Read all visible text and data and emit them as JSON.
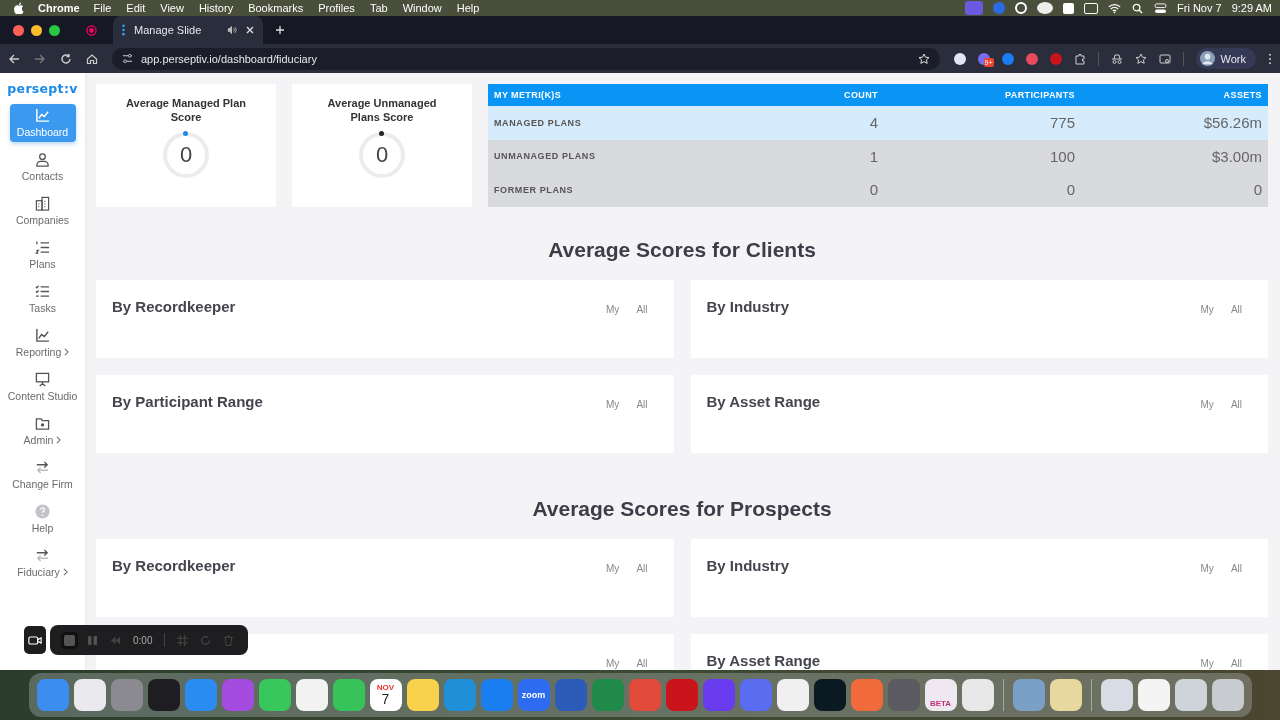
{
  "menu_bar": {
    "app": "Chrome",
    "menus": [
      "File",
      "Edit",
      "View",
      "History",
      "Bookmarks",
      "Profiles",
      "Tab",
      "Window",
      "Help"
    ],
    "date": "Fri Nov 7",
    "time": "9:29 AM"
  },
  "browser": {
    "tab": {
      "title": "Manage Slide"
    },
    "url": "app.perseptiv.io/dashboard/fiduciary",
    "extension_badge": "9+",
    "profile": "Work"
  },
  "sidebar": {
    "logo": "persept:v",
    "items": [
      {
        "label": "Dashboard",
        "kind": "chart",
        "selected": true,
        "has_submenu": false
      },
      {
        "label": "Contacts",
        "kind": "person",
        "selected": false,
        "has_submenu": false
      },
      {
        "label": "Companies",
        "kind": "building",
        "selected": false,
        "has_submenu": false
      },
      {
        "label": "Plans",
        "kind": "numbered",
        "selected": false,
        "has_submenu": false
      },
      {
        "label": "Tasks",
        "kind": "checklist",
        "selected": false,
        "has_submenu": false
      },
      {
        "label": "Reporting",
        "kind": "chart",
        "selected": false,
        "has_submenu": true
      },
      {
        "label": "Content Studio",
        "kind": "easel",
        "selected": false,
        "has_submenu": false
      },
      {
        "label": "Admin",
        "kind": "folder",
        "selected": false,
        "has_submenu": true
      },
      {
        "label": "Change Firm",
        "kind": "swap",
        "selected": false,
        "has_submenu": false
      },
      {
        "label": "Help",
        "kind": "help",
        "selected": false,
        "has_submenu": false
      },
      {
        "label": "Fiduciary",
        "kind": "swap",
        "selected": false,
        "has_submenu": true
      }
    ]
  },
  "score_cards": [
    {
      "title": "Average Managed Plan Score",
      "value": "0",
      "color": "#1e88e5"
    },
    {
      "title": "Average Unmanaged Plans Score",
      "value": "0",
      "color": "#222222"
    }
  ],
  "metrics_table": {
    "columns": [
      "MY METRI(K)S",
      "COUNT",
      "PARTICIPANTS",
      "ASSETS"
    ],
    "rows": [
      {
        "cells": [
          "MANAGED PLANS",
          "4",
          "775",
          "$56.26m"
        ],
        "selected": true
      },
      {
        "cells": [
          "UNMANAGED PLANS",
          "1",
          "100",
          "$3.00m"
        ],
        "selected": false
      },
      {
        "cells": [
          "FORMER PLANS",
          "0",
          "0",
          "0"
        ],
        "selected": false
      }
    ]
  },
  "sections": [
    {
      "heading": "Average Scores for Clients",
      "cards": [
        {
          "title": "By Recordkeeper",
          "filters": [
            "My",
            "All"
          ]
        },
        {
          "title": "By Industry",
          "filters": [
            "My",
            "All"
          ]
        },
        {
          "title": "By Participant Range",
          "filters": [
            "My",
            "All"
          ]
        },
        {
          "title": "By Asset Range",
          "filters": [
            "My",
            "All"
          ]
        }
      ]
    },
    {
      "heading": "Average Scores for Prospects",
      "cards": [
        {
          "title": "By Recordkeeper",
          "filters": [
            "My",
            "All"
          ]
        },
        {
          "title": "By Industry",
          "filters": [
            "My",
            "All"
          ]
        },
        {
          "filters": [
            "My",
            "All"
          ]
        },
        {
          "title": "By Asset Range",
          "filters": [
            "My",
            "All"
          ]
        }
      ]
    }
  ],
  "recorder": {
    "elapsed": "0:00"
  },
  "dock": [
    {
      "kind": "app",
      "color": "#3b8ef0"
    },
    {
      "kind": "app",
      "color": "#e9e9ee"
    },
    {
      "kind": "app",
      "color": "#8a8a90"
    },
    {
      "kind": "app",
      "color": "#1d1d22"
    },
    {
      "kind": "app",
      "color": "#2a8cf0"
    },
    {
      "kind": "app",
      "color": "#a44be0"
    },
    {
      "kind": "app",
      "color": "#37c75a"
    },
    {
      "kind": "app",
      "color": "#f2f2f2"
    },
    {
      "kind": "app",
      "color": "#36c45a"
    },
    {
      "kind": "calendar",
      "month": "NOV",
      "day": "7"
    },
    {
      "kind": "app",
      "color": "#f7d24a"
    },
    {
      "kind": "app",
      "color": "#1f8fd8"
    },
    {
      "kind": "app",
      "color": "#1a7ef0"
    },
    {
      "kind": "labeled",
      "color": "#2d6cf0",
      "label": "zoom"
    },
    {
      "kind": "app",
      "color": "#2b5cb8"
    },
    {
      "kind": "app",
      "color": "#1f8a4a"
    },
    {
      "kind": "app",
      "color": "#e24a3a"
    },
    {
      "kind": "app",
      "color": "#c8141a"
    },
    {
      "kind": "app",
      "color": "#6a3cf0"
    },
    {
      "kind": "app",
      "color": "#5a6cf0"
    },
    {
      "kind": "app",
      "color": "#f0f0f0"
    },
    {
      "kind": "app",
      "color": "#0b1a22"
    },
    {
      "kind": "app",
      "color": "#f06a3a"
    },
    {
      "kind": "app",
      "color": "#5a5a60"
    },
    {
      "kind": "labeled",
      "color": "#f0e8f0",
      "label": "BETA"
    },
    {
      "kind": "app",
      "color": "#e8e8e8"
    },
    {
      "kind": "separator"
    },
    {
      "kind": "app",
      "color": "#7aa0c8"
    },
    {
      "kind": "app",
      "color": "#e8d8a0"
    },
    {
      "kind": "separator"
    },
    {
      "kind": "app",
      "color": "#d8dce4"
    },
    {
      "kind": "app",
      "color": "#f4f4f4"
    },
    {
      "kind": "app",
      "color": "#cfd4da"
    },
    {
      "kind": "app",
      "color": "#c8ccd0"
    }
  ]
}
